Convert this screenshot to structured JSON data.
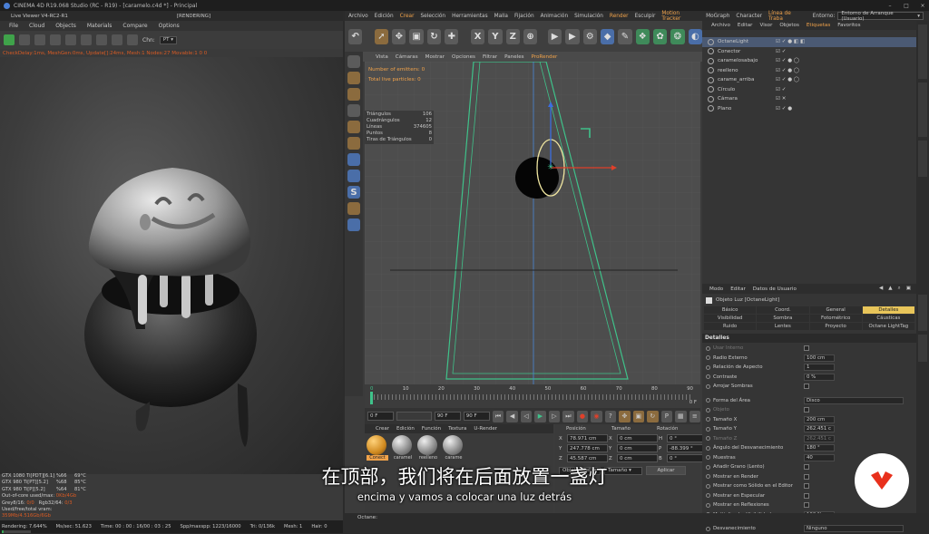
{
  "window": {
    "title": "CINEMA 4D R19.068 Studio (RC - R19) - [caramelo.c4d *] - Principal",
    "controls": [
      "–",
      "□",
      "×"
    ]
  },
  "live_viewer": {
    "title": "Live Viewer V4-RC2-R1",
    "rendering_tag": "[RENDERING]",
    "menu": [
      "File",
      "Cloud",
      "Objects",
      "Materials",
      "Compare",
      "Options"
    ],
    "channel_label": "Chn:",
    "channel_value": "PT",
    "status_line": "CheckDelay:1ms, MeshGen:0ms, Update[]:24ms, Mesh:1 Nodes:27 Movable:1  0 0",
    "gpus": [
      {
        "name": "GTX 1080 Ti[PDT][6.1]",
        "pct": "%66",
        "temp": "69°C"
      },
      {
        "name": "GTX 980 Ti[PT][5.2]",
        "pct": "%68",
        "temp": "85°C"
      },
      {
        "name": "GTX 980 Ti[P][5.2]",
        "pct": "%64",
        "temp": "81°C"
      }
    ],
    "mem_lines": [
      {
        "label": "Out-of-core used/max:",
        "value": "0Kb/4Gb"
      },
      {
        "label": "Grey8/16:",
        "value": "0/0",
        "label2": "Rgb32/64:",
        "value2": "0/3"
      },
      {
        "label": "Used/free/total vram:",
        "value": "359Mb/4.516Gb/6Gb"
      }
    ],
    "bottom": {
      "rendering": "Rendering: 7.644%",
      "msamples": "Ms/sec: 51.623",
      "time": "Time: 00 : 00 : 16/00 : 03 : 25",
      "spp": "Spp/maxspp: 1223/16000",
      "tri": "Tri: 0/136k",
      "mesh": "Mesh: 1",
      "hair": "Hair: 0",
      "progress": 0.076
    }
  },
  "menubar": {
    "items": [
      "Archivo",
      "Edición",
      "Crear",
      "Selección",
      "Herramientas",
      "Malla",
      "Fijación",
      "Animación",
      "Simulación",
      "Render",
      "Esculpir",
      "Motion Tracker",
      "MoGraph",
      "Character",
      "Línea de Traba"
    ],
    "highlight": [
      "Crear",
      "Render",
      "Motion Tracker",
      "Línea de Traba"
    ],
    "env_label": "Entorno:",
    "env_value": "Entorno de Arranque (Usuario)"
  },
  "toolbar": {
    "buttons": [
      "undo-icon",
      "cursor-icon",
      "move-icon",
      "scale-icon",
      "rotate-icon",
      "plus-icon",
      "axis-x",
      "axis-y",
      "axis-z",
      "world-icon",
      "render-view-icon",
      "render-icon",
      "render-settings-icon",
      "cube-icon",
      "pen-icon",
      "subdivision-icon",
      "cloner-icon",
      "deformer-icon",
      "scene-icon",
      "camera-icon",
      "light-icon"
    ],
    "axis_labels": [
      "X",
      "Y",
      "Z"
    ]
  },
  "viewport": {
    "menu": [
      "Vista",
      "Cámaras",
      "Mostrar",
      "Opciones",
      "Filtrar",
      "Paneles",
      "ProRender"
    ],
    "active_menu": "ProRender",
    "emitters": "Number of emitters: 0",
    "particles": "Total live particles: 0",
    "stats": [
      {
        "label": "Triángulos",
        "value": "106"
      },
      {
        "label": "Cuadrángulos",
        "value": "12"
      },
      {
        "label": "Líneas",
        "value": "374605"
      },
      {
        "label": "Puntos",
        "value": "8"
      },
      {
        "label": "Tiras de Triángulos",
        "value": "0"
      }
    ]
  },
  "timeline": {
    "ticks": [
      "0",
      "10",
      "20",
      "30",
      "40",
      "50",
      "60",
      "70",
      "80",
      "90"
    ],
    "current": "0 F",
    "start": "0 F",
    "end": "90 F",
    "end2": "90 F"
  },
  "materials": {
    "menu": [
      "Crear",
      "Edición",
      "Función",
      "Textura",
      "U-Render"
    ],
    "items": [
      "Conect",
      "caramel",
      "reelleno",
      "carame"
    ]
  },
  "coordinates": {
    "headers": [
      "Posición",
      "Tamaño",
      "Rotación"
    ],
    "rows": [
      {
        "axis": "X",
        "pos": "78.971 cm",
        "saxis": "X",
        "size": "0 cm",
        "raxis": "H",
        "rot": "0 °"
      },
      {
        "axis": "Y",
        "pos": "247.778 cm",
        "saxis": "Y",
        "size": "0 cm",
        "raxis": "P",
        "rot": "-88.399 °"
      },
      {
        "axis": "Z",
        "pos": "45.587 cm",
        "saxis": "Z",
        "size": "0 cm",
        "raxis": "B",
        "rot": "0 °"
      }
    ],
    "mode_left": "Objeto (Rel)",
    "mode_right": "Tamaño",
    "apply": "Aplicar"
  },
  "object_manager": {
    "tabs": [
      "Archivo",
      "Editar",
      "Visor",
      "Objetos",
      "Etiquetas",
      "Favoritos"
    ],
    "active_tab": "Etiquetas",
    "objects": [
      {
        "name": "OctaneLight",
        "selected": true
      },
      {
        "name": "Conector",
        "selected": false
      },
      {
        "name": "caramelosabajo",
        "selected": false
      },
      {
        "name": "reelleno",
        "selected": false
      },
      {
        "name": "carame_arriba",
        "selected": false
      },
      {
        "name": "Círculo",
        "selected": false
      },
      {
        "name": "Cámara",
        "selected": false
      },
      {
        "name": "Plano",
        "selected": false
      }
    ]
  },
  "attribute_manager": {
    "menu": [
      "Modo",
      "Editar",
      "Datos de Usuario"
    ],
    "title": "Objeto Luz [OctaneLight]",
    "tabs": [
      "Básico",
      "Coord.",
      "General",
      "Detalles",
      "Visibilidad",
      "Sombra",
      "Fotométrico",
      "Cáusticas",
      "Ruido",
      "Lentes",
      "Proyecto",
      "Octane LightTag"
    ],
    "active_tab": "Detalles",
    "section": "Detalles",
    "rows": [
      {
        "label": "Usar Interno",
        "value": "",
        "dim": true
      },
      {
        "label": "Radio Externo",
        "value": "100 cm",
        "dim": false
      },
      {
        "label": "Relación de Aspecto",
        "value": "1",
        "dim": false
      },
      {
        "label": "Contraste",
        "value": "0 %",
        "dim": false
      },
      {
        "label": "Arrojar Sombras",
        "value": "",
        "dim": false
      },
      {
        "label": "",
        "value": "",
        "dim": false
      },
      {
        "label": "Forma del Área",
        "value": "Disco",
        "dim": false
      },
      {
        "label": "Objeto",
        "value": "",
        "dim": true
      },
      {
        "label": "Tamaño X",
        "value": "200 cm",
        "dim": false
      },
      {
        "label": "Tamaño Y",
        "value": "262.451 c",
        "dim": false
      },
      {
        "label": "Tamaño Z",
        "value": "262.451 c",
        "dim": true
      },
      {
        "label": "Ángulo del Desvanecimiento",
        "value": "180 °",
        "dim": false
      },
      {
        "label": "Muestras",
        "value": "40",
        "dim": false
      },
      {
        "label": "Añadir Grano (Lento)",
        "value": "",
        "dim": false
      },
      {
        "label": "Mostrar en Render",
        "value": "",
        "dim": false
      },
      {
        "label": "Mostrar como Sólido en el Editor",
        "value": "",
        "dim": false
      },
      {
        "label": "Mostrar en Especular",
        "value": "",
        "dim": false
      },
      {
        "label": "Mostrar en Reflexiones",
        "value": "",
        "dim": false
      },
      {
        "label": "Multiplicador Visibilidad",
        "value": "100 %",
        "dim": false
      },
      {
        "label": "",
        "value": "",
        "dim": false
      },
      {
        "label": "Desvanecimiento",
        "value": "Ninguno",
        "dim": false
      }
    ]
  },
  "octane_bar": "Octane:",
  "subtitles": {
    "zh": "在顶部，我们将在后面放置一盏灯",
    "es": "encima y vamos a colocar una luz detrás"
  },
  "colors": {
    "accent": "#f0a24a",
    "logo": "#e8301c",
    "camera_frustum": "#3fc28a"
  }
}
